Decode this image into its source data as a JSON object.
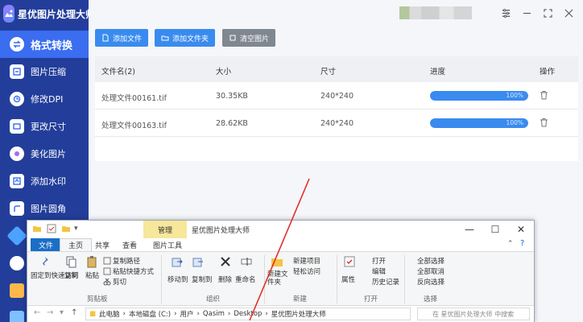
{
  "app": {
    "title": "星优图片处理大师"
  },
  "sidebar": {
    "items": [
      {
        "label": "格式转换",
        "icon": "swap-icon"
      },
      {
        "label": "图片压缩",
        "icon": "compress-icon"
      },
      {
        "label": "修改DPI",
        "icon": "dpi-icon"
      },
      {
        "label": "更改尺寸",
        "icon": "resize-icon"
      },
      {
        "label": "美化图片",
        "icon": "beautify-icon"
      },
      {
        "label": "添加水印",
        "icon": "watermark-icon"
      },
      {
        "label": "图片圆角",
        "icon": "round-corner-icon"
      }
    ]
  },
  "toolbar": {
    "add_file": "添加文件",
    "add_folder": "添加文件夹",
    "clear_list": "清空图片"
  },
  "table": {
    "headers": [
      "文件名(2)",
      "大小",
      "尺寸",
      "进度",
      "操作"
    ],
    "rows": [
      {
        "name": "处理文件00161.tif",
        "size": "30.35KB",
        "dims": "240*240",
        "progress": 100,
        "progress_label": "100%"
      },
      {
        "name": "处理文件00163.tif",
        "size": "28.62KB",
        "dims": "240*240",
        "progress": 100,
        "progress_label": "100%"
      }
    ]
  },
  "explorer": {
    "context_tab": "管理",
    "window_title": "星优图片处理大师",
    "tabs": [
      "文件",
      "主页",
      "共享",
      "查看",
      "图片工具"
    ],
    "ribbon": {
      "pin": "固定到快速访问",
      "copy": "复制",
      "paste": "粘贴",
      "copy_path": "复制路径",
      "paste_shortcut": "粘贴快捷方式",
      "cut": "剪切",
      "clipboard": "剪贴板",
      "move_to": "移动到",
      "copy_to": "复制到",
      "delete": "删除",
      "rename": "重命名",
      "organize": "组织",
      "new_folder": "新建文件夹",
      "new_item": "新建项目",
      "easy_access": "轻松访问",
      "new": "新建",
      "properties": "属性",
      "open": "打开",
      "edit": "编辑",
      "history": "历史记录",
      "open_group": "打开",
      "select_all": "全部选择",
      "select_none": "全部取消",
      "invert_select": "反向选择",
      "select_group": "选择"
    },
    "address": [
      "此电脑",
      "本地磁盘 (C:)",
      "用户",
      "Qasim",
      "Desktop",
      "星优图片处理大师"
    ],
    "search_placeholder": "在 星优图片处理大师 中搜索"
  },
  "colors": {
    "sidebar_bg": "#233e9a",
    "sidebar_active": "#3a6df0",
    "accent": "#3a8bef",
    "arrow": "#e0322a"
  }
}
